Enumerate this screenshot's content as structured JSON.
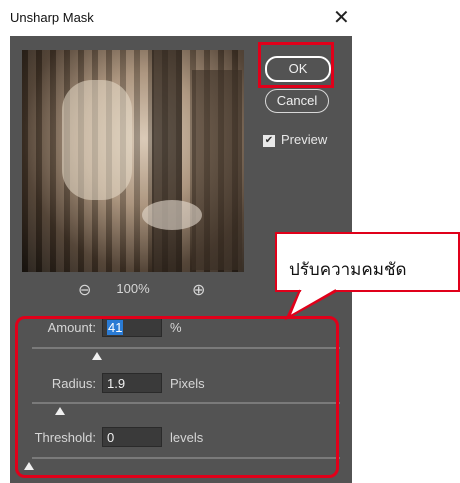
{
  "window": {
    "title": "Unsharp Mask",
    "close_icon": "close-icon"
  },
  "preview": {
    "zoom_level": "100%"
  },
  "buttons": {
    "ok": "OK",
    "cancel": "Cancel"
  },
  "preview_checkbox": {
    "label": "Preview",
    "checked": true
  },
  "controls": {
    "amount": {
      "label": "Amount:",
      "value": "41",
      "unit": "%"
    },
    "radius": {
      "label": "Radius:",
      "value": "1.9",
      "unit": "Pixels"
    },
    "threshold": {
      "label": "Threshold:",
      "value": "0",
      "unit": "levels"
    }
  },
  "annotation": {
    "text": "ปรับความคมชัด",
    "highlight_color": "#e0001a"
  }
}
